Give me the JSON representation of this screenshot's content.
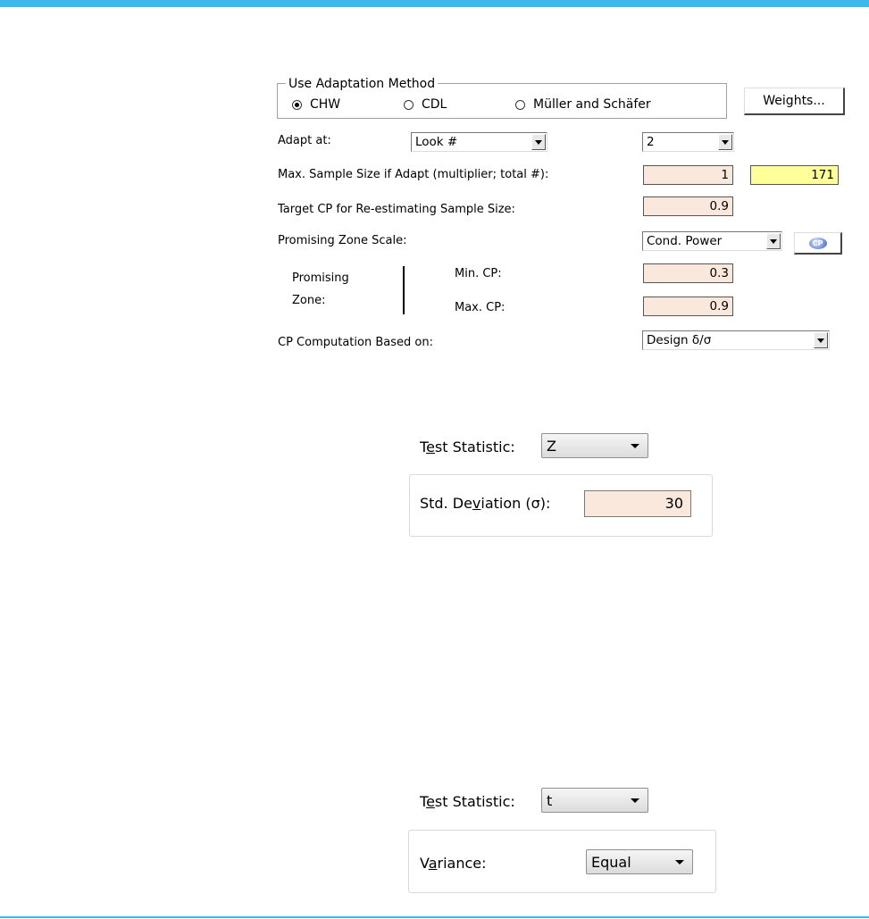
{
  "adaptation": {
    "legend": "Use Adaptation Method",
    "options": [
      "CHW",
      "CDL",
      "Müller and Schäfer"
    ],
    "selected": "CHW",
    "weights_button": "Weights..."
  },
  "adapt_at": {
    "label": "Adapt at:",
    "mode_value": "Look #",
    "look_value": "2"
  },
  "max_sample": {
    "label": "Max. Sample Size if Adapt (multiplier; total #):",
    "multiplier": "1",
    "total": "171"
  },
  "target_cp": {
    "label": "Target CP for Re-estimating Sample Size:",
    "value": "0.9"
  },
  "promising_scale": {
    "label": "Promising Zone Scale:",
    "value": "Cond. Power",
    "cp_button_icon": "cp-icon",
    "cp_button_text": "CP"
  },
  "promising_zone": {
    "label_line1": "Promising",
    "label_line2": "Zone:",
    "min_label": "Min. CP:",
    "min_value": "0.3",
    "max_label": "Max. CP:",
    "max_value": "0.9"
  },
  "cp_based": {
    "label": "CP Computation Based on:",
    "value": "Design δ/σ"
  },
  "panel1": {
    "test_label_pre": "T",
    "test_label_u": "e",
    "test_label_post": "st Statistic:",
    "test_value": "Z",
    "std_label_pre": "Std. De",
    "std_label_u": "v",
    "std_label_post": "iation (σ):",
    "std_value": "30"
  },
  "panel2": {
    "test_label_pre": "T",
    "test_label_u": "e",
    "test_label_post": "st Statistic:",
    "test_value": "t",
    "var_label_pre": "V",
    "var_label_u": "a",
    "var_label_post": "riance:",
    "var_value": "Equal"
  }
}
